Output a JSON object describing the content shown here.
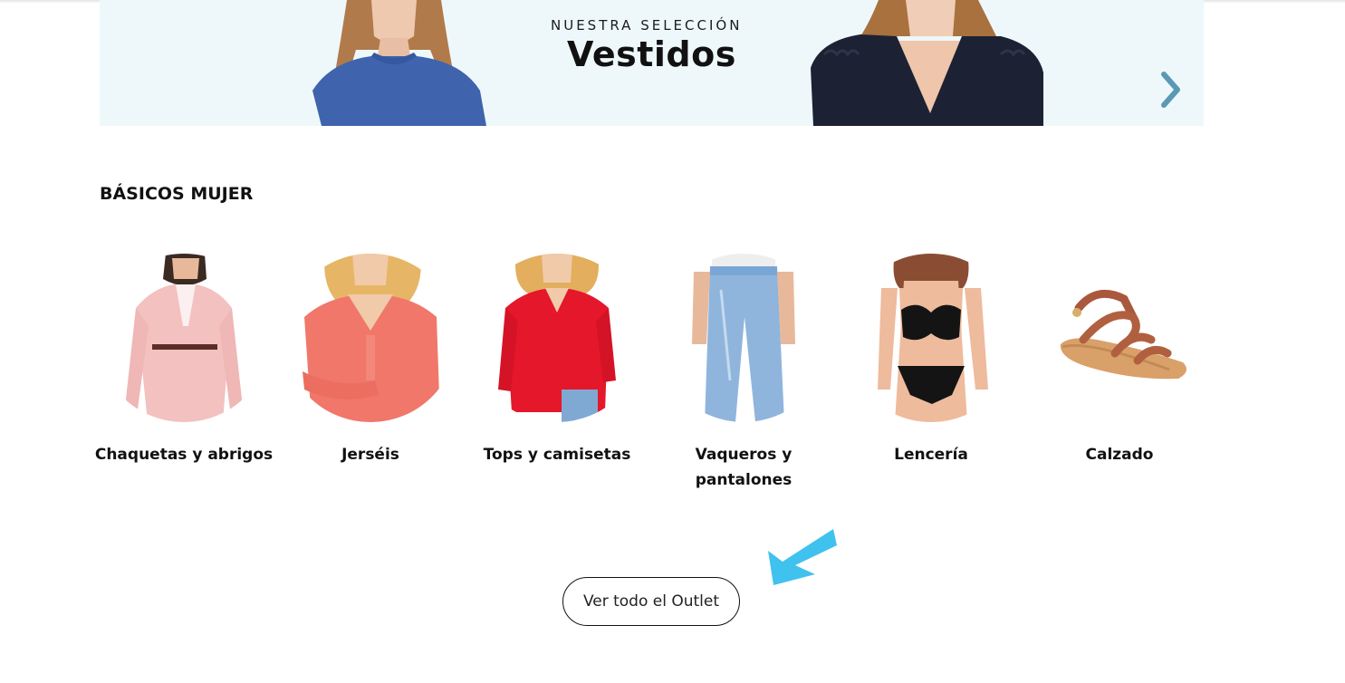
{
  "banner": {
    "eyebrow": "NUESTRA SELECCIÓN",
    "title": "Vestidos",
    "next_icon": "chevron-right-icon",
    "background_color": "#eef8fa"
  },
  "section": {
    "title": "BÁSICOS MUJER"
  },
  "categories": [
    {
      "label": "Chaquetas y abrigos",
      "image": "pink-blazer-image"
    },
    {
      "label": "Jerséis",
      "image": "coral-sweater-image"
    },
    {
      "label": "Tops y camisetas",
      "image": "red-blouse-image"
    },
    {
      "label": "Vaqueros y pantalones",
      "image": "jeans-image"
    },
    {
      "label": "Lencería",
      "image": "lingerie-image"
    },
    {
      "label": "Calzado",
      "image": "sandal-image"
    }
  ],
  "cta": {
    "label": "Ver todo el Outlet"
  },
  "annotation": {
    "icon": "arrow-pointer-icon",
    "color": "#3fc2ee"
  }
}
